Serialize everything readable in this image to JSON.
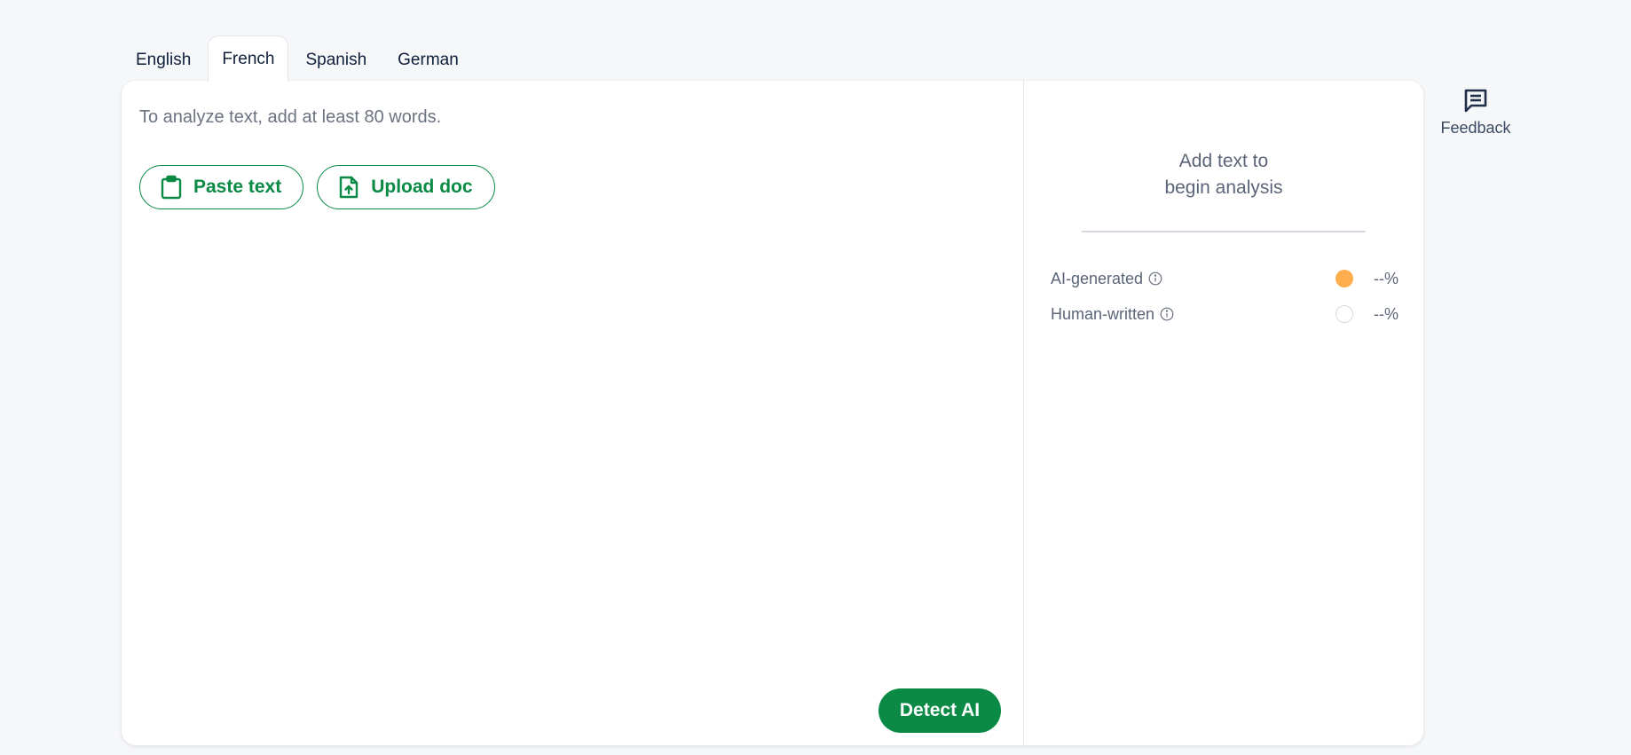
{
  "tabs": [
    {
      "label": "English",
      "active": false
    },
    {
      "label": "French",
      "active": true
    },
    {
      "label": "Spanish",
      "active": false
    },
    {
      "label": "German",
      "active": false
    }
  ],
  "editor": {
    "placeholder": "To analyze text, add at least 80 words.",
    "paste_label": "Paste text",
    "upload_label": "Upload doc",
    "detect_label": "Detect AI"
  },
  "results": {
    "prompt_line1": "Add text to",
    "prompt_line2": "begin analysis",
    "metrics": [
      {
        "label": "AI-generated",
        "value": "--%",
        "dot_color": "#ffad4d"
      },
      {
        "label": "Human-written",
        "value": "--%",
        "dot_color": "#ffffff"
      }
    ]
  },
  "feedback": {
    "label": "Feedback"
  },
  "colors": {
    "accent": "#0a8a45",
    "ai_dot": "#ffad4d",
    "background": "#f6f7f9"
  },
  "icons": {
    "paste": "clipboard-icon",
    "upload": "file-upload-icon",
    "info": "info-icon",
    "feedback": "message-icon"
  }
}
